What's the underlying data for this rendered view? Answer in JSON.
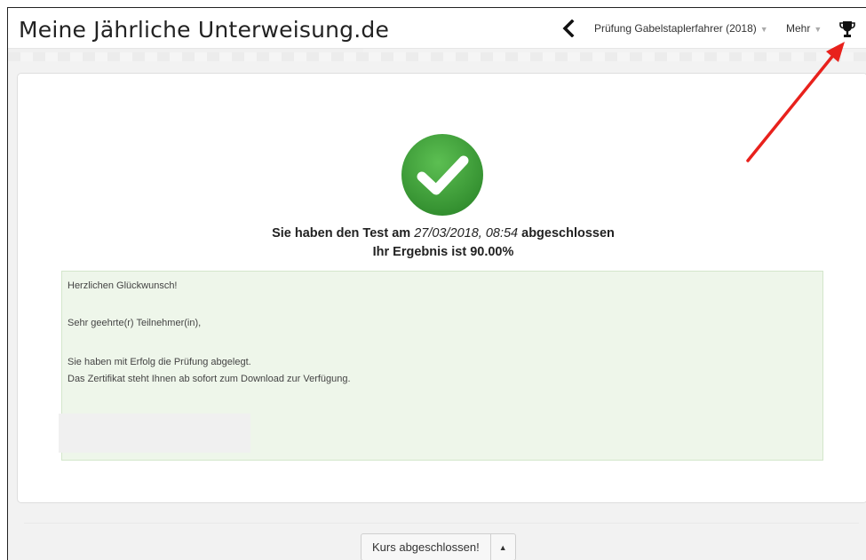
{
  "header": {
    "brand": "Meine Jährliche Unterweisung.de",
    "back_icon": "chevron-left-icon",
    "course_menu_label": "Prüfung Gabelstaplerfahrer (2018)",
    "more_menu_label": "Mehr",
    "caret_glyph": "▼",
    "trophy_icon": "trophy-icon"
  },
  "result": {
    "status_icon": "check-circle-icon",
    "status_color": "#3f9e3a",
    "completed_prefix": "Sie haben den Test am",
    "completed_date": "27/03/2018, 08:54",
    "completed_suffix": "abgeschlossen",
    "score_text": "Ihr Ergebnis ist 90.00%"
  },
  "message": {
    "line1": "Herzlichen Glückwunsch!",
    "line2": "Sehr geehrte(r) Teilnehmer(in),",
    "line3": "Sie haben mit Erfolg die Prüfung abgelegt.",
    "line4": "Das Zertifikat steht Ihnen ab sofort zum Download zur Verfügung."
  },
  "footer": {
    "complete_button": "Kurs abgeschlossen!",
    "dropdown_glyph": "▲"
  },
  "colors": {
    "annotation_arrow": "#e8211c",
    "message_background": "#eef6ea"
  }
}
